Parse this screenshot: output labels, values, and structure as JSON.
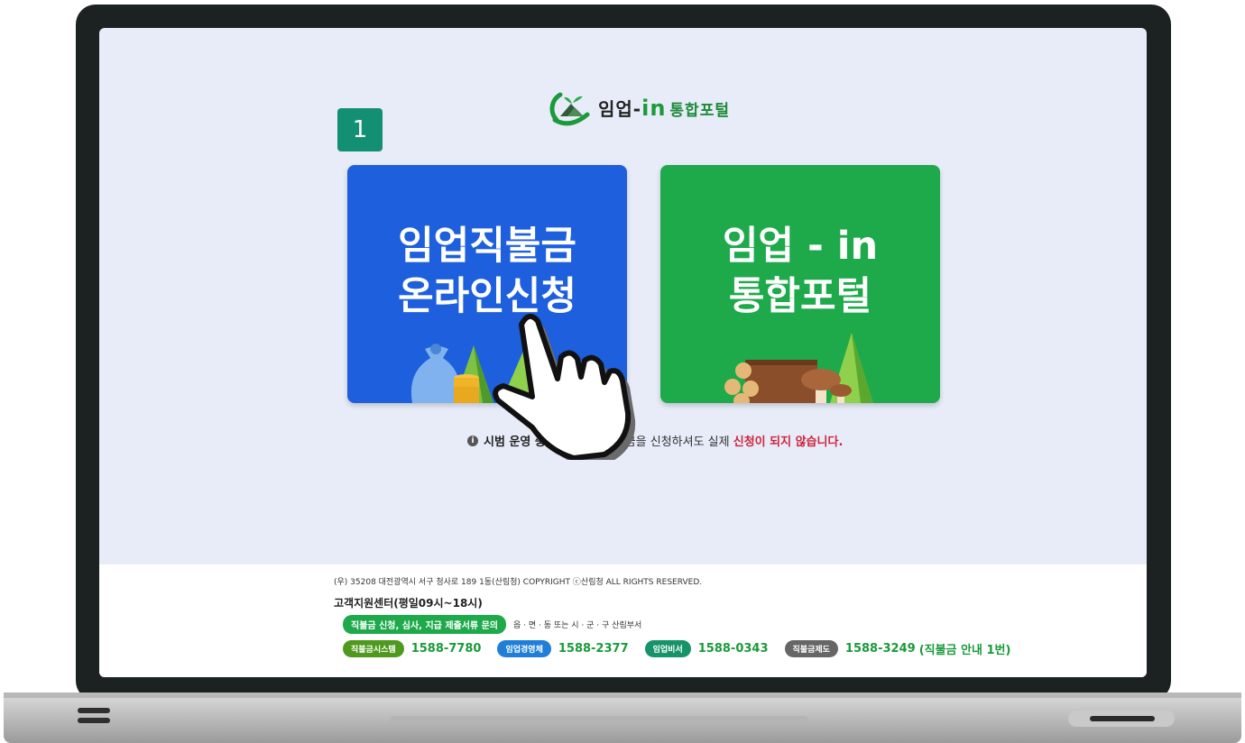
{
  "portal": {
    "logo_main": "임업-",
    "logo_in": "in",
    "logo_sub": "통합포털"
  },
  "step_badge": "1",
  "cards": {
    "payment": {
      "line1": "임업직불금",
      "line2": "온라인신청",
      "color": "#1d5fdc"
    },
    "portal": {
      "line1": "임업 - in",
      "line2": "통합포털",
      "color": "#1ea94b"
    }
  },
  "notice": {
    "icon": "info-icon",
    "bold": "시범 운영 중입",
    "text": "업직불금을 신청하셔도 실제",
    "red": "신청이 되지 않습니다."
  },
  "footer": {
    "address": "(우) 35208 대전광역시 서구 청사로 189 1동(산림청) COPYRIGHT ⓒ산림청 ALL RIGHTS RESERVED.",
    "support_title": "고객지원센터(평일09시~18시)",
    "inquiry_pill": "직불금 신청, 심사, 지급 제출서류 문의",
    "inquiry_text": "읍 · 면 · 동 또는 시 · 군 · 구 산림부서",
    "contacts": [
      {
        "label": "직불금시스템",
        "number": "1588-7780",
        "color": "#4e9a1e"
      },
      {
        "label": "임업경영체",
        "number": "1588-2377",
        "color": "#1f7fd8"
      },
      {
        "label": "임업비서",
        "number": "1588-0343",
        "color": "#17936a"
      },
      {
        "label": "직불금제도",
        "number": "1588-3249",
        "note": "(직불금 안내 1번)",
        "color": "#666666"
      }
    ]
  },
  "accent_green": "#1a9a3a",
  "accent_red": "#d0233c"
}
